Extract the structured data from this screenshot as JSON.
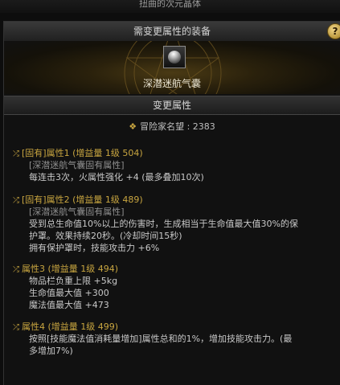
{
  "window": {
    "title": "扭曲的次元晶体"
  },
  "panel": {
    "header": "需变更属性的装备",
    "help_label": "?",
    "item": {
      "name": "深潜迷航气囊",
      "icon": "airbag-item-icon"
    },
    "section_header": "变更属性",
    "fame": {
      "label": "冒险家名望 : 2383",
      "icon": "fame-icon"
    }
  },
  "attributes": [
    {
      "title": "[固有]属性1 (增益量 1级 504)",
      "source": "[深潜迷航气囊固有属性]",
      "lines": [
        "每连击3次，火属性强化 +4 (最多叠加10次)"
      ]
    },
    {
      "title": "[固有]属性2 (增益量 1级 489)",
      "source": "[深潜迷航气囊固有属性]",
      "lines": [
        "受到总生命值10%以上的伤害时，生成相当于生命值最大值30%的保",
        "护罩。效果持续20秒。(冷却时间15秒)",
        "拥有保护罩时，技能攻击力 +6%"
      ]
    },
    {
      "title": "属性3 (增益量 1级 494)",
      "source": "",
      "lines": [
        "物品栏负重上限 +5kg",
        "生命值最大值 +300",
        "魔法值最大值 +473"
      ]
    },
    {
      "title": "属性4 (增益量 1级 499)",
      "source": "",
      "lines": [
        "按照[技能魔法值消耗量增加]属性总和的1%，增加技能攻击力。(最",
        "多增加7%)"
      ]
    }
  ]
}
